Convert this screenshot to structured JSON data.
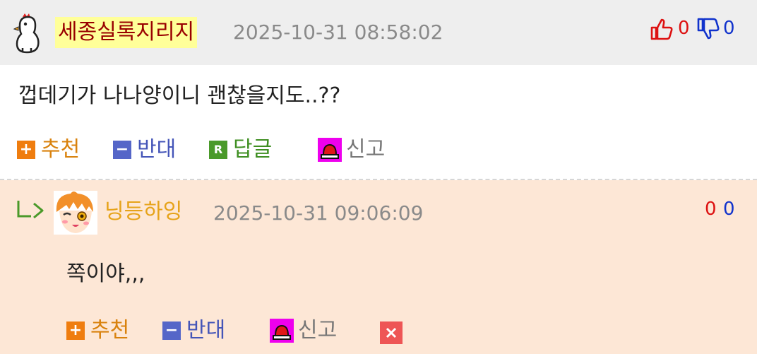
{
  "comment": {
    "author": "세종실록지리지",
    "timestamp": "2025-10-31 08:58:02",
    "upvotes": "0",
    "downvotes": "0",
    "body": "껍데기가 나나양이니 괜찮을지도..??",
    "actions": {
      "recommend": "추천",
      "oppose": "반대",
      "reply": "답글",
      "report": "신고",
      "reply_badge": "R"
    }
  },
  "reply": {
    "author": "닝등하잉",
    "timestamp": "2025-10-31 09:06:09",
    "upvotes": "0",
    "downvotes": "0",
    "body": "쪽이야,,,",
    "actions": {
      "recommend": "추천",
      "oppose": "반대",
      "report": "신고"
    }
  },
  "colors": {
    "author_highlight": "#ffff99",
    "author_text": "#990000",
    "reply_author_text": "#e6a31a",
    "upvote": "#dd1111",
    "downvote": "#1133cc",
    "recommend_box": "#ef7d0f",
    "oppose_box": "#5566c8",
    "reply_box": "#4a9a2a",
    "report_box": "#ee00ee",
    "delete_box": "#ee5555",
    "reply_bg": "#fde7d6"
  },
  "icons": {
    "comment_avatar": "chicken-avatar-icon",
    "thumbs_up": "thumbs-up-icon",
    "thumbs_down": "thumbs-down-icon",
    "reply_arrow": "reply-arrow-icon",
    "reply_avatar": "anime-girl-avatar",
    "siren": "siren-icon",
    "delete": "close-icon"
  }
}
